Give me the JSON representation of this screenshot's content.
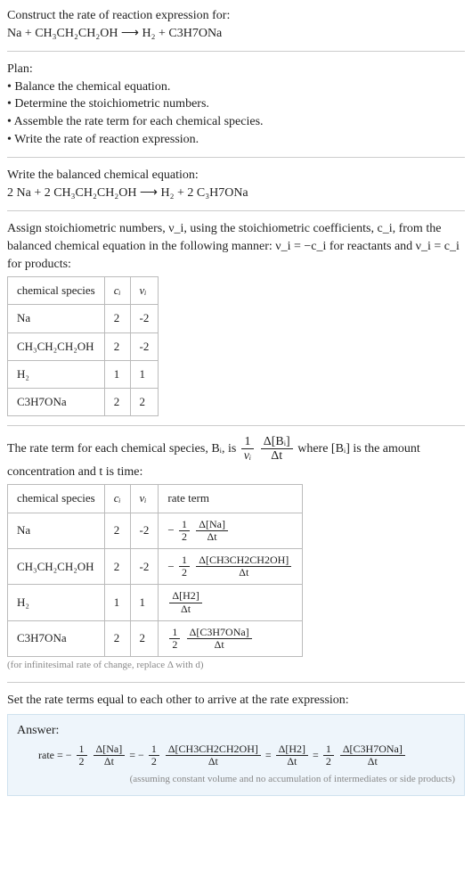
{
  "header": {
    "prompt": "Construct the rate of reaction expression for:",
    "equation": "Na + CH₃CH₂CH₂OH ⟶ H₂ + C3H7ONa"
  },
  "plan": {
    "title": "Plan:",
    "items": [
      "Balance the chemical equation.",
      "Determine the stoichiometric numbers.",
      "Assemble the rate term for each chemical species.",
      "Write the rate of reaction expression."
    ]
  },
  "balanced": {
    "intro": "Write the balanced chemical equation:",
    "equation": "2 Na + 2 CH₃CH₂CH₂OH ⟶ H₂ + 2 C₃H7ONa"
  },
  "stoich": {
    "intro_a": "Assign stoichiometric numbers, ν_i, using the stoichiometric coefficients, c_i, from the balanced chemical equation in the following manner: ν_i = −c_i for reactants and ν_i = c_i for products:",
    "headers": {
      "species": "chemical species",
      "ci": "cᵢ",
      "vi": "νᵢ"
    },
    "rows": [
      {
        "species": "Na",
        "ci": "2",
        "vi": "-2"
      },
      {
        "species": "CH₃CH₂CH₂OH",
        "ci": "2",
        "vi": "-2"
      },
      {
        "species": "H₂",
        "ci": "1",
        "vi": "1"
      },
      {
        "species": "C3H7ONa",
        "ci": "2",
        "vi": "2"
      }
    ]
  },
  "rateterm": {
    "intro_pre": "The rate term for each chemical species, Bᵢ, is ",
    "intro_post": " where [Bᵢ] is the amount concentration and t is time:",
    "frac1_num": "1",
    "frac1_den": "νᵢ",
    "frac2_num": "Δ[Bᵢ]",
    "frac2_den": "Δt",
    "headers": {
      "species": "chemical species",
      "ci": "cᵢ",
      "vi": "νᵢ",
      "rate": "rate term"
    },
    "rows": [
      {
        "species": "Na",
        "ci": "2",
        "vi": "-2",
        "prefix": "−",
        "coef_num": "1",
        "coef_den": "2",
        "dnum": "Δ[Na]",
        "dden": "Δt"
      },
      {
        "species": "CH₃CH₂CH₂OH",
        "ci": "2",
        "vi": "-2",
        "prefix": "−",
        "coef_num": "1",
        "coef_den": "2",
        "dnum": "Δ[CH3CH2CH2OH]",
        "dden": "Δt"
      },
      {
        "species": "H₂",
        "ci": "1",
        "vi": "1",
        "prefix": "",
        "coef_num": "",
        "coef_den": "",
        "dnum": "Δ[H2]",
        "dden": "Δt"
      },
      {
        "species": "C3H7ONa",
        "ci": "2",
        "vi": "2",
        "prefix": "",
        "coef_num": "1",
        "coef_den": "2",
        "dnum": "Δ[C3H7ONa]",
        "dden": "Δt"
      }
    ],
    "note": "(for infinitesimal rate of change, replace Δ with d)"
  },
  "final": {
    "intro": "Set the rate terms equal to each other to arrive at the rate expression:",
    "answer_label": "Answer:",
    "rate_label": "rate",
    "eq": "=",
    "terms": [
      {
        "prefix": "−",
        "coef_num": "1",
        "coef_den": "2",
        "dnum": "Δ[Na]",
        "dden": "Δt"
      },
      {
        "prefix": "−",
        "coef_num": "1",
        "coef_den": "2",
        "dnum": "Δ[CH3CH2CH2OH]",
        "dden": "Δt"
      },
      {
        "prefix": "",
        "coef_num": "",
        "coef_den": "",
        "dnum": "Δ[H2]",
        "dden": "Δt"
      },
      {
        "prefix": "",
        "coef_num": "1",
        "coef_den": "2",
        "dnum": "Δ[C3H7ONa]",
        "dden": "Δt"
      }
    ],
    "assumption": "(assuming constant volume and no accumulation of intermediates or side products)"
  }
}
